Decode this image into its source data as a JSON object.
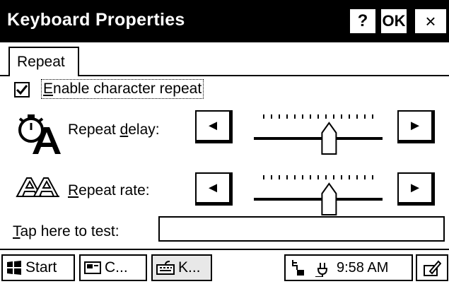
{
  "window": {
    "title": "Keyboard Properties",
    "help_label": "?",
    "ok_label": "OK",
    "close_label": "×"
  },
  "tabs": [
    {
      "label": "Repeat",
      "selected": true
    }
  ],
  "repeat": {
    "enable_label": "Enable character repeat",
    "enable_underline": "E",
    "enable_rest": "nable character repeat",
    "enabled": true,
    "delay": {
      "label_pre": "Repeat ",
      "label_u": "d",
      "label_post": "elay:",
      "level": 0.6,
      "ticks": 15
    },
    "rate": {
      "label_pre": "",
      "label_u": "R",
      "label_post": "epeat rate:",
      "level": 0.6,
      "ticks": 15
    },
    "left_arrow": "◄",
    "right_arrow": "►"
  },
  "test": {
    "label_u": "T",
    "label_rest": "ap here to test:",
    "value": ""
  },
  "taskbar": {
    "start_label": "Start",
    "items": [
      {
        "label": "C..."
      },
      {
        "label": "K...",
        "active": true
      }
    ],
    "clock": "9:58 AM"
  }
}
